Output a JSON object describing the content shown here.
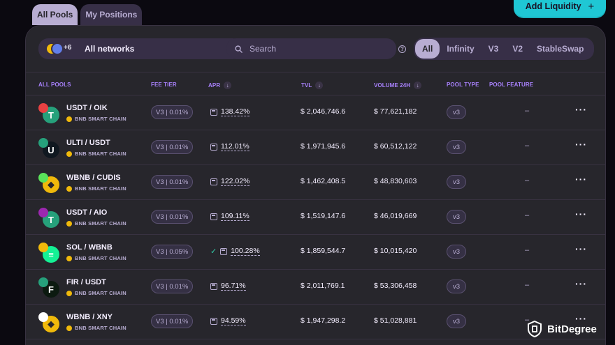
{
  "tabs": [
    {
      "label": "All Pools",
      "active": true
    },
    {
      "label": "My Positions",
      "active": false
    }
  ],
  "add_liquidity": {
    "label": "Add Liquidity",
    "icon": "plus-icon"
  },
  "network_select": {
    "label": "All networks",
    "more_count": "+6"
  },
  "search": {
    "placeholder": "Search",
    "value": ""
  },
  "pool_types": [
    {
      "label": "All",
      "active": true
    },
    {
      "label": "Infinity",
      "active": false
    },
    {
      "label": "V3",
      "active": false
    },
    {
      "label": "V2",
      "active": false
    },
    {
      "label": "StableSwap",
      "active": false
    }
  ],
  "columns": {
    "all_pools": "ALL POOLS",
    "fee_tier": "FEE TIER",
    "apr": "APR",
    "tvl": "TVL",
    "volume": "VOLUME 24H",
    "pool_type": "POOL TYPE",
    "pool_feature": "POOL FEATURE"
  },
  "rows": [
    {
      "pair": "USDT / OIK",
      "chain": "BNB SMART CHAIN",
      "fee": "V3 | 0.01%",
      "apr": "138.42%",
      "farm": false,
      "tvl": "$ 2,046,746.6",
      "volume": "$ 77,621,182",
      "type": "v3",
      "feature": "–",
      "colors": [
        "#e84142",
        "#26a17b"
      ],
      "glyph": "T"
    },
    {
      "pair": "ULTI / USDT",
      "chain": "BNB SMART CHAIN",
      "fee": "V3 | 0.01%",
      "apr": "112.01%",
      "farm": false,
      "tvl": "$ 1,971,945.6",
      "volume": "$ 60,512,122",
      "type": "v3",
      "feature": "–",
      "colors": [
        "#26a17b",
        "#101820"
      ],
      "glyph": "U"
    },
    {
      "pair": "WBNB / CUDIS",
      "chain": "BNB SMART CHAIN",
      "fee": "V3 | 0.01%",
      "apr": "122.02%",
      "farm": false,
      "tvl": "$ 1,462,408.5",
      "volume": "$ 48,830,603",
      "type": "v3",
      "feature": "–",
      "colors": [
        "#5ae25a",
        "#f0b90b"
      ],
      "glyph": "◆"
    },
    {
      "pair": "USDT / AIO",
      "chain": "BNB SMART CHAIN",
      "fee": "V3 | 0.01%",
      "apr": "109.11%",
      "farm": false,
      "tvl": "$ 1,519,147.6",
      "volume": "$ 46,019,669",
      "type": "v3",
      "feature": "–",
      "colors": [
        "#9c27b0",
        "#26a17b"
      ],
      "glyph": "T"
    },
    {
      "pair": "SOL / WBNB",
      "chain": "BNB SMART CHAIN",
      "fee": "V3 | 0.05%",
      "apr": "100.28%",
      "farm": true,
      "tvl": "$ 1,859,544.7",
      "volume": "$ 10,015,420",
      "type": "v3",
      "feature": "–",
      "colors": [
        "#f0b90b",
        "#14f195"
      ],
      "glyph": "≡"
    },
    {
      "pair": "FIR / USDT",
      "chain": "BNB SMART CHAIN",
      "fee": "V3 | 0.01%",
      "apr": "96.71%",
      "farm": false,
      "tvl": "$ 2,011,769.1",
      "volume": "$ 53,306,458",
      "type": "v3",
      "feature": "–",
      "colors": [
        "#26a17b",
        "#0c1a10"
      ],
      "glyph": "F"
    },
    {
      "pair": "WBNB / XNY",
      "chain": "BNB SMART CHAIN",
      "fee": "V3 | 0.01%",
      "apr": "94.59%",
      "farm": false,
      "tvl": "$ 1,947,298.2",
      "volume": "$ 51,028,881",
      "type": "v3",
      "feature": "–",
      "colors": [
        "#ffffff",
        "#f0b90b"
      ],
      "glyph": "◆"
    }
  ],
  "watermark": {
    "text": "BitDegree"
  },
  "colors": {
    "accent": "#1fc7d4",
    "purple": "#a881fc",
    "card": "#27262c"
  }
}
